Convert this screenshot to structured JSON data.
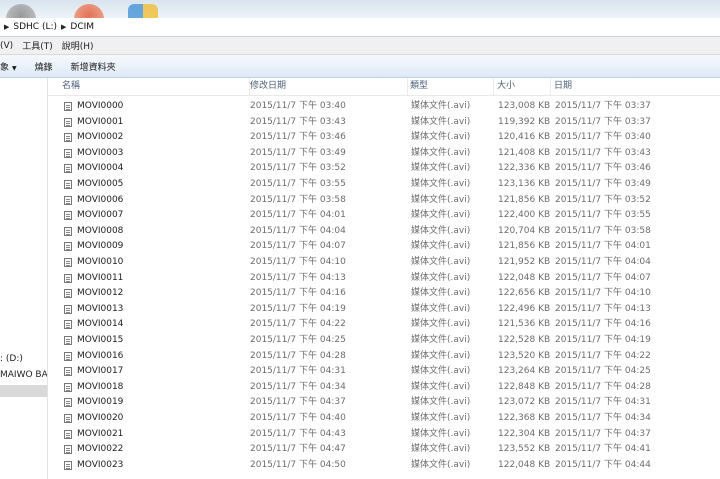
{
  "address": {
    "crumbs": [
      "SDHC (L:)",
      "DCIM"
    ]
  },
  "menu": {
    "items": [
      "(V)",
      "工具(T)",
      "說明(H)"
    ]
  },
  "toolbar": {
    "organize_label": "象",
    "burn_label": "燒錄",
    "new_folder_label": "新增資料夾"
  },
  "nav": {
    "items": [
      ": (D:)",
      "MAIWO BACK"
    ]
  },
  "columns": {
    "name": "名稱",
    "modified": "修改日期",
    "type": "類型",
    "size": "大小",
    "date": "日期"
  },
  "files": [
    {
      "name": "MOVI0000",
      "modified": "2015/11/7 下午 03:40",
      "type": "媒体文件(.avi)",
      "size": "123,008 KB",
      "date": "2015/11/7 下午 03:37"
    },
    {
      "name": "MOVI0001",
      "modified": "2015/11/7 下午 03:43",
      "type": "媒体文件(.avi)",
      "size": "119,392 KB",
      "date": "2015/11/7 下午 03:37"
    },
    {
      "name": "MOVI0002",
      "modified": "2015/11/7 下午 03:46",
      "type": "媒体文件(.avi)",
      "size": "120,416 KB",
      "date": "2015/11/7 下午 03:40"
    },
    {
      "name": "MOVI0003",
      "modified": "2015/11/7 下午 03:49",
      "type": "媒体文件(.avi)",
      "size": "121,408 KB",
      "date": "2015/11/7 下午 03:43"
    },
    {
      "name": "MOVI0004",
      "modified": "2015/11/7 下午 03:52",
      "type": "媒体文件(.avi)",
      "size": "122,336 KB",
      "date": "2015/11/7 下午 03:46"
    },
    {
      "name": "MOVI0005",
      "modified": "2015/11/7 下午 03:55",
      "type": "媒体文件(.avi)",
      "size": "123,136 KB",
      "date": "2015/11/7 下午 03:49"
    },
    {
      "name": "MOVI0006",
      "modified": "2015/11/7 下午 03:58",
      "type": "媒体文件(.avi)",
      "size": "121,856 KB",
      "date": "2015/11/7 下午 03:52"
    },
    {
      "name": "MOVI0007",
      "modified": "2015/11/7 下午 04:01",
      "type": "媒体文件(.avi)",
      "size": "122,400 KB",
      "date": "2015/11/7 下午 03:55"
    },
    {
      "name": "MOVI0008",
      "modified": "2015/11/7 下午 04:04",
      "type": "媒体文件(.avi)",
      "size": "120,704 KB",
      "date": "2015/11/7 下午 03:58"
    },
    {
      "name": "MOVI0009",
      "modified": "2015/11/7 下午 04:07",
      "type": "媒体文件(.avi)",
      "size": "121,856 KB",
      "date": "2015/11/7 下午 04:01"
    },
    {
      "name": "MOVI0010",
      "modified": "2015/11/7 下午 04:10",
      "type": "媒体文件(.avi)",
      "size": "121,952 KB",
      "date": "2015/11/7 下午 04:04"
    },
    {
      "name": "MOVI0011",
      "modified": "2015/11/7 下午 04:13",
      "type": "媒体文件(.avi)",
      "size": "122,048 KB",
      "date": "2015/11/7 下午 04:07"
    },
    {
      "name": "MOVI0012",
      "modified": "2015/11/7 下午 04:16",
      "type": "媒体文件(.avi)",
      "size": "122,656 KB",
      "date": "2015/11/7 下午 04:10"
    },
    {
      "name": "MOVI0013",
      "modified": "2015/11/7 下午 04:19",
      "type": "媒体文件(.avi)",
      "size": "122,496 KB",
      "date": "2015/11/7 下午 04:13"
    },
    {
      "name": "MOVI0014",
      "modified": "2015/11/7 下午 04:22",
      "type": "媒体文件(.avi)",
      "size": "121,536 KB",
      "date": "2015/11/7 下午 04:16"
    },
    {
      "name": "MOVI0015",
      "modified": "2015/11/7 下午 04:25",
      "type": "媒体文件(.avi)",
      "size": "122,528 KB",
      "date": "2015/11/7 下午 04:19"
    },
    {
      "name": "MOVI0016",
      "modified": "2015/11/7 下午 04:28",
      "type": "媒体文件(.avi)",
      "size": "123,520 KB",
      "date": "2015/11/7 下午 04:22"
    },
    {
      "name": "MOVI0017",
      "modified": "2015/11/7 下午 04:31",
      "type": "媒体文件(.avi)",
      "size": "123,264 KB",
      "date": "2015/11/7 下午 04:25"
    },
    {
      "name": "MOVI0018",
      "modified": "2015/11/7 下午 04:34",
      "type": "媒体文件(.avi)",
      "size": "122,848 KB",
      "date": "2015/11/7 下午 04:28"
    },
    {
      "name": "MOVI0019",
      "modified": "2015/11/7 下午 04:37",
      "type": "媒体文件(.avi)",
      "size": "123,072 KB",
      "date": "2015/11/7 下午 04:31"
    },
    {
      "name": "MOVI0020",
      "modified": "2015/11/7 下午 04:40",
      "type": "媒体文件(.avi)",
      "size": "122,368 KB",
      "date": "2015/11/7 下午 04:34"
    },
    {
      "name": "MOVI0021",
      "modified": "2015/11/7 下午 04:43",
      "type": "媒体文件(.avi)",
      "size": "122,304 KB",
      "date": "2015/11/7 下午 04:37"
    },
    {
      "name": "MOVI0022",
      "modified": "2015/11/7 下午 04:47",
      "type": "媒体文件(.avi)",
      "size": "123,552 KB",
      "date": "2015/11/7 下午 04:41"
    },
    {
      "name": "MOVI0023",
      "modified": "2015/11/7 下午 04:50",
      "type": "媒体文件(.avi)",
      "size": "122,048 KB",
      "date": "2015/11/7 下午 04:44"
    }
  ]
}
